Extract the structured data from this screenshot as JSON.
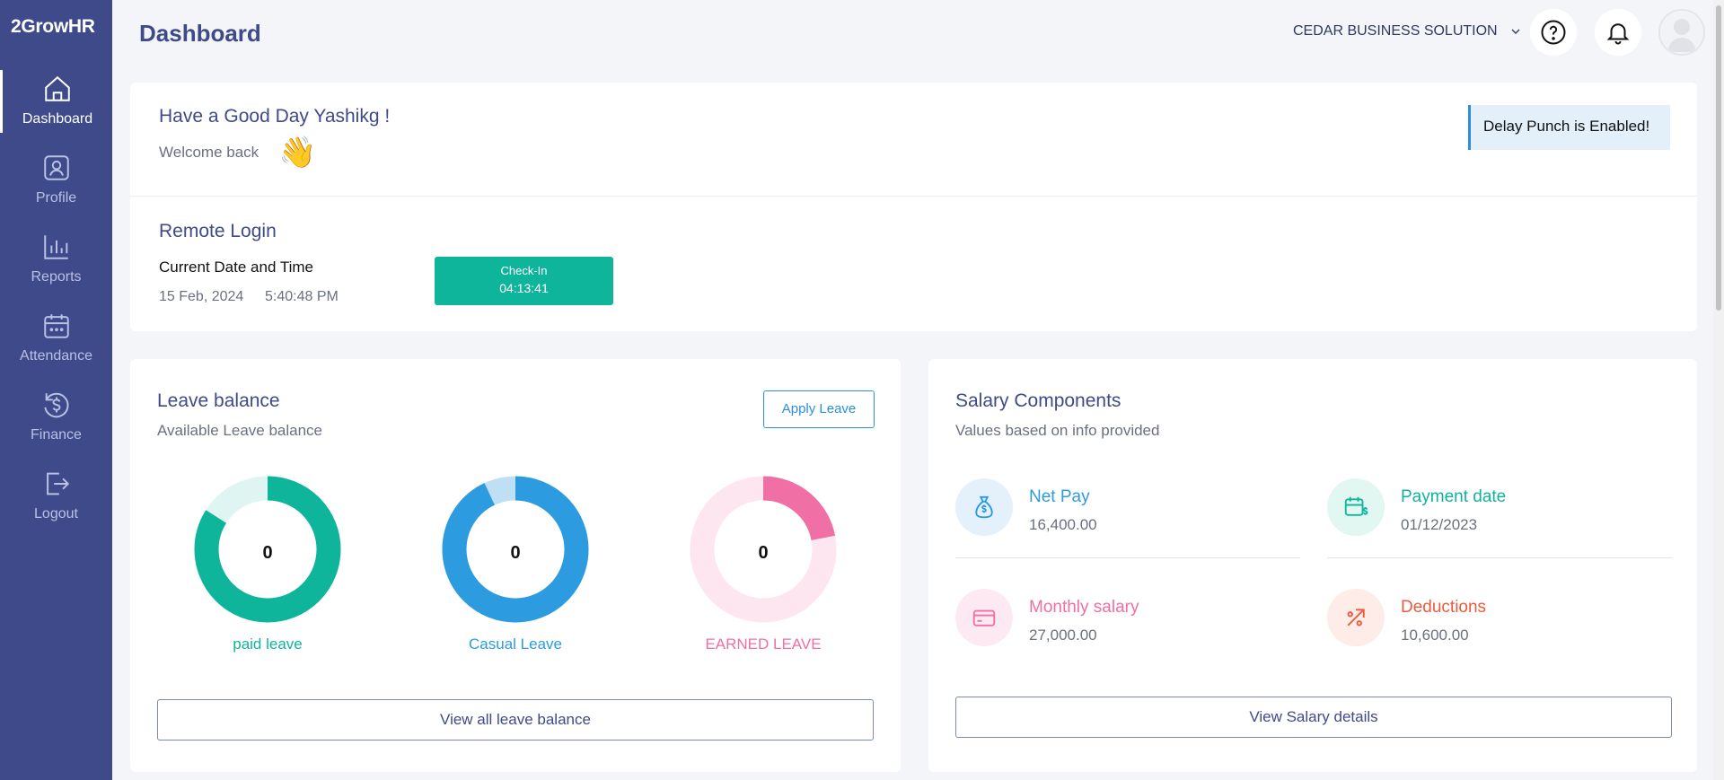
{
  "app": {
    "logo_text": "2GrowHR"
  },
  "sidebar": {
    "items": [
      {
        "label": "Dashboard",
        "icon": "home-icon"
      },
      {
        "label": "Profile",
        "icon": "profile-icon"
      },
      {
        "label": "Reports",
        "icon": "bar-chart-icon"
      },
      {
        "label": "Attendance",
        "icon": "calendar-icon"
      },
      {
        "label": "Finance",
        "icon": "finance-icon"
      },
      {
        "label": "Logout",
        "icon": "logout-icon"
      }
    ],
    "active": "Dashboard"
  },
  "header": {
    "title": "Dashboard",
    "company": "CEDAR BUSINESS SOLUTION"
  },
  "welcome": {
    "greeting": "Have a Good Day Yashikg !",
    "subtitle": "Welcome back",
    "emoji": "👋",
    "badge": "Delay Punch is Enabled!"
  },
  "remote_login": {
    "title": "Remote Login",
    "label": "Current Date and Time",
    "date": "15 Feb, 2024",
    "time": "5:40:48 PM",
    "checkin_label": "Check-In",
    "checkin_time": "04:13:41"
  },
  "leave": {
    "title": "Leave balance",
    "subtitle": "Available Leave balance",
    "apply_button": "Apply Leave",
    "view_all_button": "View all leave balance",
    "types": [
      {
        "label": "paid leave",
        "value": "0",
        "color": "#0fb59b",
        "fill_fraction": 0.84
      },
      {
        "label": "Casual Leave",
        "value": "0",
        "color": "#2d9be0",
        "fill_fraction": 0.93
      },
      {
        "label": "EARNED LEAVE",
        "value": "0",
        "color": "#f06fa5",
        "fill_fraction": 0.22
      }
    ]
  },
  "salary": {
    "title": "Salary Components",
    "subtitle": "Values based on info provided",
    "view_button": "View Salary details",
    "items": [
      {
        "label": "Net Pay",
        "value": "16,400.00",
        "icon": "money-bag-icon",
        "color": "#2d9be0"
      },
      {
        "label": "Payment date",
        "value": "01/12/2023",
        "icon": "payment-calendar-icon",
        "color": "#0fb59b"
      },
      {
        "label": "Monthly salary",
        "value": "27,000.00",
        "icon": "credit-card-icon",
        "color": "#f06fa5"
      },
      {
        "label": "Deductions",
        "value": "10,600.00",
        "icon": "percent-arrow-icon",
        "color": "#ee5a3b"
      }
    ]
  }
}
